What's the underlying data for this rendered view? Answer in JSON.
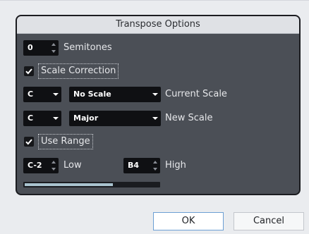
{
  "dialog": {
    "title": "Transpose Options"
  },
  "semitones": {
    "value": "0",
    "label": "Semitones"
  },
  "scale_correction": {
    "label": "Scale Correction",
    "checked": true
  },
  "current_scale": {
    "root": "C",
    "scale": "No Scale",
    "label": "Current Scale"
  },
  "new_scale": {
    "root": "C",
    "scale": "Major",
    "label": "New Scale"
  },
  "use_range": {
    "label": "Use Range",
    "checked": true
  },
  "range": {
    "low_value": "C-2",
    "low_label": "Low",
    "high_value": "B4",
    "high_label": "High",
    "fill_fraction": 0.66
  },
  "buttons": {
    "ok": "OK",
    "cancel": "Cancel"
  },
  "colors": {
    "panel": "#4b4f56",
    "field": "#0f1013",
    "progress_fill": "#a9c3cf",
    "default_button_border": "#6c9fd4"
  }
}
